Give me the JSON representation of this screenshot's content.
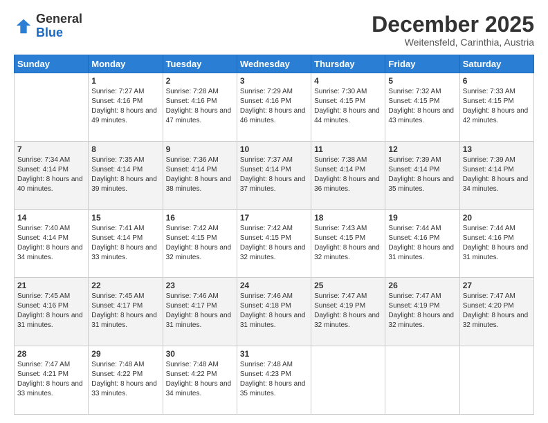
{
  "logo": {
    "general": "General",
    "blue": "Blue"
  },
  "header": {
    "month": "December 2025",
    "location": "Weitensfeld, Carinthia, Austria"
  },
  "weekdays": [
    "Sunday",
    "Monday",
    "Tuesday",
    "Wednesday",
    "Thursday",
    "Friday",
    "Saturday"
  ],
  "weeks": [
    [
      {
        "day": "",
        "sunrise": "",
        "sunset": "",
        "daylight": ""
      },
      {
        "day": "1",
        "sunrise": "Sunrise: 7:27 AM",
        "sunset": "Sunset: 4:16 PM",
        "daylight": "Daylight: 8 hours and 49 minutes."
      },
      {
        "day": "2",
        "sunrise": "Sunrise: 7:28 AM",
        "sunset": "Sunset: 4:16 PM",
        "daylight": "Daylight: 8 hours and 47 minutes."
      },
      {
        "day": "3",
        "sunrise": "Sunrise: 7:29 AM",
        "sunset": "Sunset: 4:16 PM",
        "daylight": "Daylight: 8 hours and 46 minutes."
      },
      {
        "day": "4",
        "sunrise": "Sunrise: 7:30 AM",
        "sunset": "Sunset: 4:15 PM",
        "daylight": "Daylight: 8 hours and 44 minutes."
      },
      {
        "day": "5",
        "sunrise": "Sunrise: 7:32 AM",
        "sunset": "Sunset: 4:15 PM",
        "daylight": "Daylight: 8 hours and 43 minutes."
      },
      {
        "day": "6",
        "sunrise": "Sunrise: 7:33 AM",
        "sunset": "Sunset: 4:15 PM",
        "daylight": "Daylight: 8 hours and 42 minutes."
      }
    ],
    [
      {
        "day": "7",
        "sunrise": "Sunrise: 7:34 AM",
        "sunset": "Sunset: 4:14 PM",
        "daylight": "Daylight: 8 hours and 40 minutes."
      },
      {
        "day": "8",
        "sunrise": "Sunrise: 7:35 AM",
        "sunset": "Sunset: 4:14 PM",
        "daylight": "Daylight: 8 hours and 39 minutes."
      },
      {
        "day": "9",
        "sunrise": "Sunrise: 7:36 AM",
        "sunset": "Sunset: 4:14 PM",
        "daylight": "Daylight: 8 hours and 38 minutes."
      },
      {
        "day": "10",
        "sunrise": "Sunrise: 7:37 AM",
        "sunset": "Sunset: 4:14 PM",
        "daylight": "Daylight: 8 hours and 37 minutes."
      },
      {
        "day": "11",
        "sunrise": "Sunrise: 7:38 AM",
        "sunset": "Sunset: 4:14 PM",
        "daylight": "Daylight: 8 hours and 36 minutes."
      },
      {
        "day": "12",
        "sunrise": "Sunrise: 7:39 AM",
        "sunset": "Sunset: 4:14 PM",
        "daylight": "Daylight: 8 hours and 35 minutes."
      },
      {
        "day": "13",
        "sunrise": "Sunrise: 7:39 AM",
        "sunset": "Sunset: 4:14 PM",
        "daylight": "Daylight: 8 hours and 34 minutes."
      }
    ],
    [
      {
        "day": "14",
        "sunrise": "Sunrise: 7:40 AM",
        "sunset": "Sunset: 4:14 PM",
        "daylight": "Daylight: 8 hours and 34 minutes."
      },
      {
        "day": "15",
        "sunrise": "Sunrise: 7:41 AM",
        "sunset": "Sunset: 4:14 PM",
        "daylight": "Daylight: 8 hours and 33 minutes."
      },
      {
        "day": "16",
        "sunrise": "Sunrise: 7:42 AM",
        "sunset": "Sunset: 4:15 PM",
        "daylight": "Daylight: 8 hours and 32 minutes."
      },
      {
        "day": "17",
        "sunrise": "Sunrise: 7:42 AM",
        "sunset": "Sunset: 4:15 PM",
        "daylight": "Daylight: 8 hours and 32 minutes."
      },
      {
        "day": "18",
        "sunrise": "Sunrise: 7:43 AM",
        "sunset": "Sunset: 4:15 PM",
        "daylight": "Daylight: 8 hours and 32 minutes."
      },
      {
        "day": "19",
        "sunrise": "Sunrise: 7:44 AM",
        "sunset": "Sunset: 4:16 PM",
        "daylight": "Daylight: 8 hours and 31 minutes."
      },
      {
        "day": "20",
        "sunrise": "Sunrise: 7:44 AM",
        "sunset": "Sunset: 4:16 PM",
        "daylight": "Daylight: 8 hours and 31 minutes."
      }
    ],
    [
      {
        "day": "21",
        "sunrise": "Sunrise: 7:45 AM",
        "sunset": "Sunset: 4:16 PM",
        "daylight": "Daylight: 8 hours and 31 minutes."
      },
      {
        "day": "22",
        "sunrise": "Sunrise: 7:45 AM",
        "sunset": "Sunset: 4:17 PM",
        "daylight": "Daylight: 8 hours and 31 minutes."
      },
      {
        "day": "23",
        "sunrise": "Sunrise: 7:46 AM",
        "sunset": "Sunset: 4:17 PM",
        "daylight": "Daylight: 8 hours and 31 minutes."
      },
      {
        "day": "24",
        "sunrise": "Sunrise: 7:46 AM",
        "sunset": "Sunset: 4:18 PM",
        "daylight": "Daylight: 8 hours and 31 minutes."
      },
      {
        "day": "25",
        "sunrise": "Sunrise: 7:47 AM",
        "sunset": "Sunset: 4:19 PM",
        "daylight": "Daylight: 8 hours and 32 minutes."
      },
      {
        "day": "26",
        "sunrise": "Sunrise: 7:47 AM",
        "sunset": "Sunset: 4:19 PM",
        "daylight": "Daylight: 8 hours and 32 minutes."
      },
      {
        "day": "27",
        "sunrise": "Sunrise: 7:47 AM",
        "sunset": "Sunset: 4:20 PM",
        "daylight": "Daylight: 8 hours and 32 minutes."
      }
    ],
    [
      {
        "day": "28",
        "sunrise": "Sunrise: 7:47 AM",
        "sunset": "Sunset: 4:21 PM",
        "daylight": "Daylight: 8 hours and 33 minutes."
      },
      {
        "day": "29",
        "sunrise": "Sunrise: 7:48 AM",
        "sunset": "Sunset: 4:22 PM",
        "daylight": "Daylight: 8 hours and 33 minutes."
      },
      {
        "day": "30",
        "sunrise": "Sunrise: 7:48 AM",
        "sunset": "Sunset: 4:22 PM",
        "daylight": "Daylight: 8 hours and 34 minutes."
      },
      {
        "day": "31",
        "sunrise": "Sunrise: 7:48 AM",
        "sunset": "Sunset: 4:23 PM",
        "daylight": "Daylight: 8 hours and 35 minutes."
      },
      {
        "day": "",
        "sunrise": "",
        "sunset": "",
        "daylight": ""
      },
      {
        "day": "",
        "sunrise": "",
        "sunset": "",
        "daylight": ""
      },
      {
        "day": "",
        "sunrise": "",
        "sunset": "",
        "daylight": ""
      }
    ]
  ]
}
